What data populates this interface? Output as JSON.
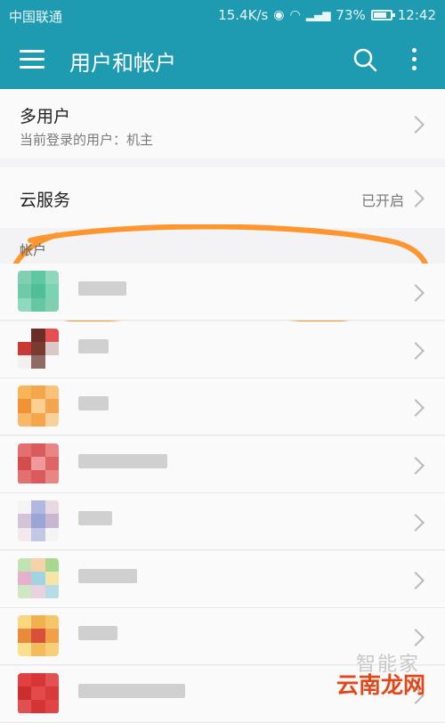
{
  "status": {
    "carrier": "中国联通",
    "net_speed": "15.4K/s",
    "battery": "73%",
    "time": "12:42"
  },
  "appbar": {
    "title": "用户和帐户"
  },
  "users": {
    "title": "多用户",
    "subtitle": "当前登录的用户：机主"
  },
  "cloud": {
    "title": "云服务",
    "status": "已开启"
  },
  "accounts": {
    "section_title": "帐户",
    "count": 8
  },
  "watermark": "智能家",
  "corner_brand": "云南龙网",
  "colors": {
    "appbar": "#1f9bb1",
    "highlight_ring": "#ff8c1a"
  }
}
